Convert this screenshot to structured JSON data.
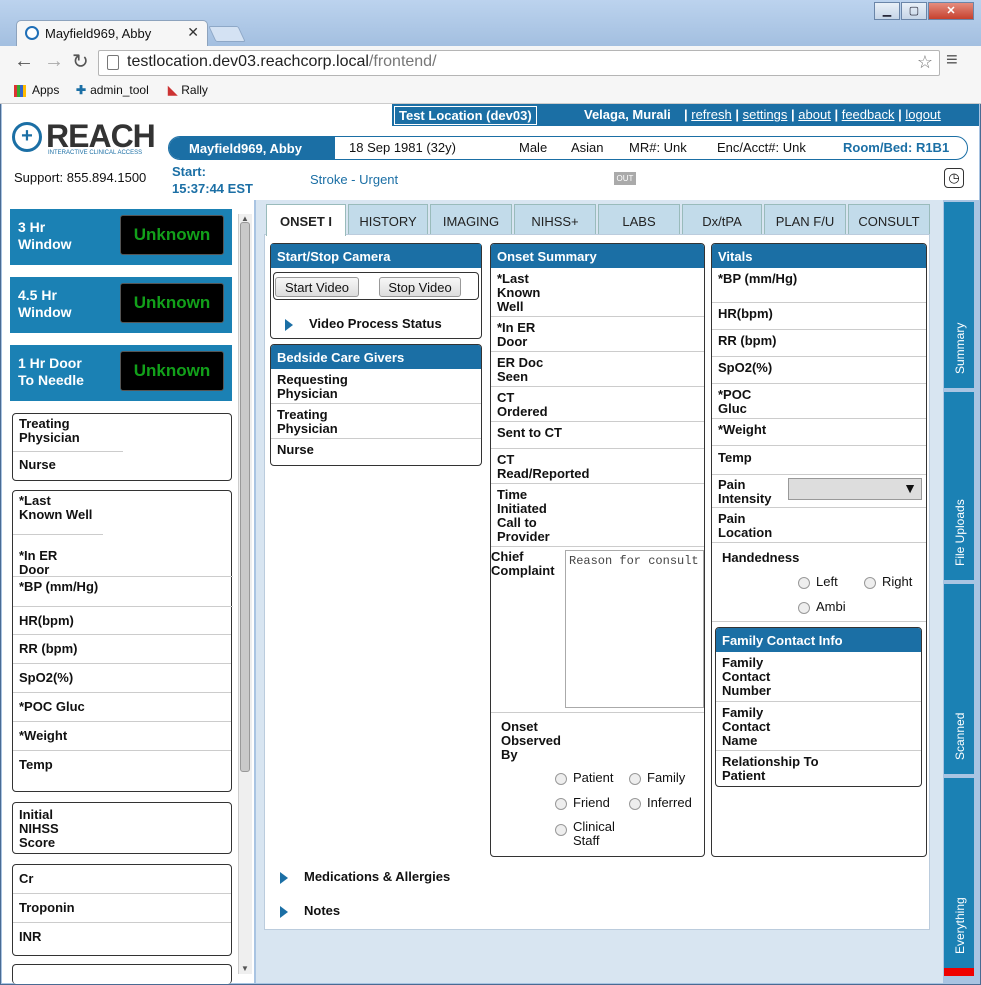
{
  "browser": {
    "tab_title": "Mayfield969, Abby",
    "url_host": "testlocation.dev03.reachcorp.local",
    "url_path": "/frontend/",
    "bookmarks": [
      "Apps",
      "admin_tool",
      "Rally"
    ]
  },
  "header": {
    "location": "Test Location (dev03)",
    "user": "Velaga, Murali",
    "links": [
      "refresh",
      "settings",
      "about",
      "feedback",
      "logout"
    ],
    "logo": "REACH",
    "logo_tagline": "INTERACTIVE CLINICAL ACCESS",
    "support": "Support: 855.894.1500",
    "start_label": "Start:",
    "start_time": "15:37:44 EST",
    "case_type": "Stroke - Urgent",
    "out_badge": "OUT"
  },
  "patient": {
    "name": "Mayfield969, Abby",
    "dob": "18 Sep 1981 (32y)",
    "sex": "Male",
    "race": "Asian",
    "mr": "MR#: Unk",
    "enc": "Enc/Acct#: Unk",
    "room": "Room/Bed: R1B1"
  },
  "timers": [
    {
      "label": "3 Hr\nWindow",
      "l1": "3 Hr",
      "l2": "Window",
      "value": "Unknown"
    },
    {
      "l1": "4.5 Hr",
      "l2": "Window",
      "value": "Unknown"
    },
    {
      "l1": "1 Hr Door",
      "l2": "To Needle",
      "value": "Unknown"
    }
  ],
  "left_care": [
    "Treating Physician",
    "Nurse"
  ],
  "left_vitals": [
    "*Last Known Well",
    "*In ER Door",
    "*BP (mm/Hg)",
    "HR(bpm)",
    "RR (bpm)",
    "SpO2(%)",
    "*POC Gluc",
    "*Weight",
    "Temp"
  ],
  "left_nihss": "Initial NIHSS Score",
  "left_labs": [
    "Cr",
    "Troponin",
    "INR"
  ],
  "tabs": [
    "ONSET I",
    "HISTORY",
    "IMAGING",
    "NIHSS+",
    "LABS",
    "Dx/tPA",
    "PLAN F/U",
    "CONSULT"
  ],
  "camera": {
    "title": "Start/Stop Camera",
    "start": "Start Video",
    "stop": "Stop Video",
    "status": "Video Process Status"
  },
  "bedside": {
    "title": "Bedside Care Givers",
    "rows": [
      "Requesting Physician",
      "Treating Physician",
      "Nurse"
    ]
  },
  "onset": {
    "title": "Onset Summary",
    "rows": [
      "*Last Known Well",
      "*In ER Door",
      "ER Doc Seen",
      "CT Ordered",
      "Sent to CT",
      "CT Read/Reported",
      "Time Initiated Call to Provider"
    ],
    "chief_label": "Chief Complaint",
    "chief_placeholder": "Reason for consult",
    "observed_label": "Onset Observed By",
    "observed_options": [
      "Patient",
      "Family",
      "Friend",
      "Inferred",
      "Clinical Staff"
    ]
  },
  "vitals": {
    "title": "Vitals",
    "rows": [
      "*BP (mm/Hg)",
      "HR(bpm)",
      "RR (bpm)",
      "SpO2(%)",
      "*POC Gluc",
      "*Weight",
      "Temp"
    ],
    "pain_intensity": "Pain Intensity",
    "pain_location": "Pain Location",
    "handedness": "Handedness",
    "hand_options": [
      "Left",
      "Right",
      "Ambi"
    ]
  },
  "family": {
    "title": "Family Contact Info",
    "rows": [
      "Family Contact Number",
      "Family Contact Name",
      "Relationship To Patient"
    ]
  },
  "expanders": [
    "Medications & Allergies",
    "Notes"
  ],
  "side_tabs": [
    "Summary",
    "File Uploads",
    "Scanned",
    "Everything"
  ],
  "colors": {
    "brand": "#1b6fa5",
    "timer_value": "#12a01a"
  }
}
